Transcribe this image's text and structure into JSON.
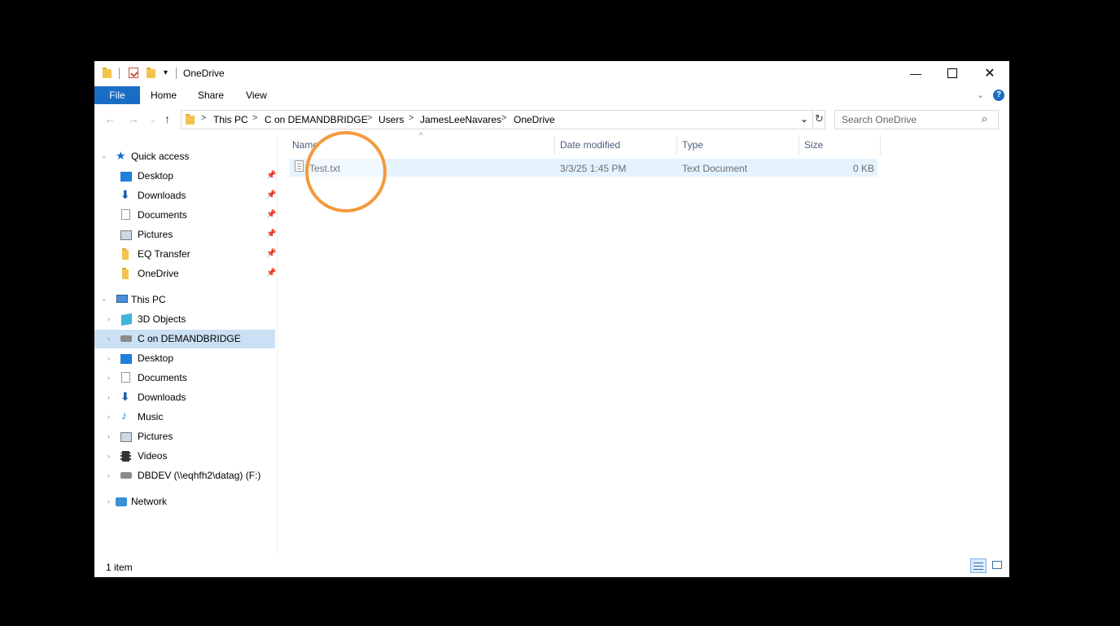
{
  "window": {
    "title": "OneDrive"
  },
  "ribbon": {
    "tabs": [
      "File",
      "Home",
      "Share",
      "View"
    ]
  },
  "address": {
    "parts": [
      "This PC",
      "C on DEMANDBRIDGE",
      "Users",
      "JamesLeeNavares",
      "OneDrive"
    ]
  },
  "search": {
    "placeholder": "Search OneDrive"
  },
  "nav": {
    "quick_access": {
      "label": "Quick access",
      "items": [
        "Desktop",
        "Downloads",
        "Documents",
        "Pictures",
        "EQ Transfer",
        "OneDrive"
      ]
    },
    "this_pc": {
      "label": "This PC",
      "items": [
        "3D Objects",
        "C on DEMANDBRIDGE",
        "Desktop",
        "Documents",
        "Downloads",
        "Music",
        "Pictures",
        "Videos",
        "DBDEV (\\\\eqhfh2\\datag) (F:)"
      ]
    },
    "network": {
      "label": "Network"
    }
  },
  "columns": {
    "name": "Name",
    "date": "Date modified",
    "type": "Type",
    "size": "Size"
  },
  "files": [
    {
      "name": "Test.txt",
      "date": "3/3/25 1:45 PM",
      "type": "Text Document",
      "size": "0 KB"
    }
  ],
  "status": {
    "count": "1 item"
  },
  "colors": {
    "accent": "#1a6dc4",
    "selection": "#cce0f5",
    "highlight_ring": "#f39a3c"
  }
}
